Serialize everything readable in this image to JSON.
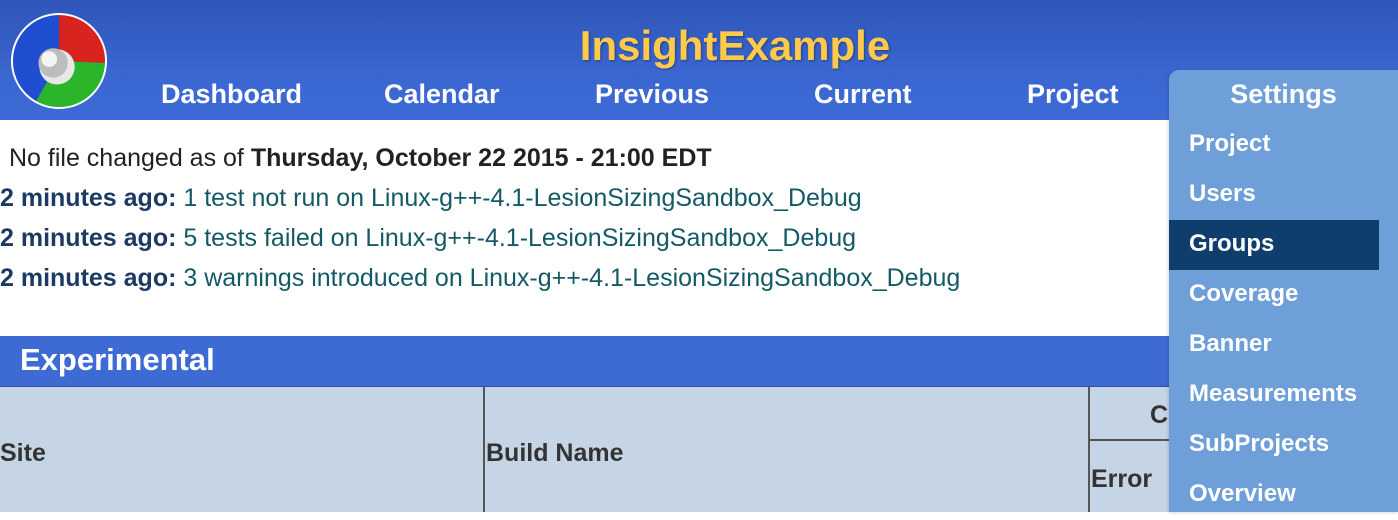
{
  "app": {
    "title": "InsightExample"
  },
  "nav": {
    "items": [
      {
        "label": "Dashboard"
      },
      {
        "label": "Calendar"
      },
      {
        "label": "Previous"
      },
      {
        "label": "Current"
      },
      {
        "label": "Project"
      }
    ]
  },
  "settings_menu": {
    "title": "Settings",
    "items": [
      {
        "label": "Project",
        "active": false
      },
      {
        "label": "Users",
        "active": false
      },
      {
        "label": "Groups",
        "active": true
      },
      {
        "label": "Coverage",
        "active": false
      },
      {
        "label": "Banner",
        "active": false
      },
      {
        "label": "Measurements",
        "active": false
      },
      {
        "label": "SubProjects",
        "active": false
      },
      {
        "label": "Overview",
        "active": false
      }
    ]
  },
  "status": {
    "prefix": "No file changed as of ",
    "date": "Thursday, October 22 2015 - 21:00 EDT"
  },
  "events": [
    {
      "ago": "2 minutes ago:",
      "text": "1 test not run on Linux-g++-4.1-LesionSizingSandbox_Debug"
    },
    {
      "ago": "2 minutes ago:",
      "text": "5 tests failed on Linux-g++-4.1-LesionSizingSandbox_Debug"
    },
    {
      "ago": "2 minutes ago:",
      "text": "3 warnings introduced on Linux-g++-4.1-LesionSizingSandbox_Debug"
    }
  ],
  "section": {
    "title": "Experimental"
  },
  "table": {
    "columns": {
      "site": "Site",
      "build_name": "Build Name",
      "group_partial": "C",
      "error": "Error"
    }
  },
  "colors": {
    "header": "#3a66d0",
    "title": "#ffc94a",
    "menu": "#6e9fd8",
    "menu_active": "#0f3d6c",
    "table_header": "#c6d5e6"
  }
}
